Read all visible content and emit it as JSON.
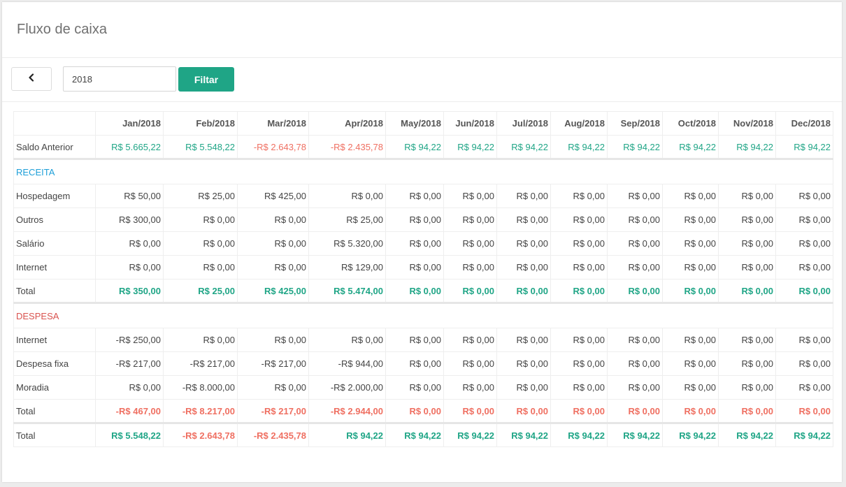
{
  "page_title": "Fluxo de caixa",
  "toolbar": {
    "back_icon": "chevron-left-icon",
    "year_value": "2018",
    "filter_label": "Filtar"
  },
  "colors": {
    "positive": "#1fa586",
    "negative": "#ef6f61",
    "receita": "#1e9fd8",
    "despesa": "#d9534f",
    "button": "#1fa586"
  },
  "table": {
    "months": [
      "Jan/2018",
      "Feb/2018",
      "Mar/2018",
      "Apr/2018",
      "May/2018",
      "Jun/2018",
      "Jul/2018",
      "Aug/2018",
      "Sep/2018",
      "Oct/2018",
      "Nov/2018",
      "Dec/2018"
    ],
    "saldo_anterior": {
      "label": "Saldo Anterior",
      "values": [
        "R$ 5.665,22",
        "R$ 5.548,22",
        "-R$ 2.643,78",
        "-R$ 2.435,78",
        "R$ 94,22",
        "R$ 94,22",
        "R$ 94,22",
        "R$ 94,22",
        "R$ 94,22",
        "R$ 94,22",
        "R$ 94,22",
        "R$ 94,22"
      ]
    },
    "receita": {
      "title": "RECEITA",
      "rows": [
        {
          "label": "Hospedagem",
          "values": [
            "R$ 50,00",
            "R$ 25,00",
            "R$ 425,00",
            "R$ 0,00",
            "R$ 0,00",
            "R$ 0,00",
            "R$ 0,00",
            "R$ 0,00",
            "R$ 0,00",
            "R$ 0,00",
            "R$ 0,00",
            "R$ 0,00"
          ]
        },
        {
          "label": "Outros",
          "values": [
            "R$ 300,00",
            "R$ 0,00",
            "R$ 0,00",
            "R$ 25,00",
            "R$ 0,00",
            "R$ 0,00",
            "R$ 0,00",
            "R$ 0,00",
            "R$ 0,00",
            "R$ 0,00",
            "R$ 0,00",
            "R$ 0,00"
          ]
        },
        {
          "label": "Salário",
          "values": [
            "R$ 0,00",
            "R$ 0,00",
            "R$ 0,00",
            "R$ 5.320,00",
            "R$ 0,00",
            "R$ 0,00",
            "R$ 0,00",
            "R$ 0,00",
            "R$ 0,00",
            "R$ 0,00",
            "R$ 0,00",
            "R$ 0,00"
          ]
        },
        {
          "label": "Internet",
          "values": [
            "R$ 0,00",
            "R$ 0,00",
            "R$ 0,00",
            "R$ 129,00",
            "R$ 0,00",
            "R$ 0,00",
            "R$ 0,00",
            "R$ 0,00",
            "R$ 0,00",
            "R$ 0,00",
            "R$ 0,00",
            "R$ 0,00"
          ]
        }
      ],
      "total": {
        "label": "Total",
        "values": [
          "R$ 350,00",
          "R$ 25,00",
          "R$ 425,00",
          "R$ 5.474,00",
          "R$ 0,00",
          "R$ 0,00",
          "R$ 0,00",
          "R$ 0,00",
          "R$ 0,00",
          "R$ 0,00",
          "R$ 0,00",
          "R$ 0,00"
        ]
      }
    },
    "despesa": {
      "title": "DESPESA",
      "rows": [
        {
          "label": "Internet",
          "values": [
            "-R$ 250,00",
            "R$ 0,00",
            "R$ 0,00",
            "R$ 0,00",
            "R$ 0,00",
            "R$ 0,00",
            "R$ 0,00",
            "R$ 0,00",
            "R$ 0,00",
            "R$ 0,00",
            "R$ 0,00",
            "R$ 0,00"
          ]
        },
        {
          "label": "Despesa fixa",
          "values": [
            "-R$ 217,00",
            "-R$ 217,00",
            "-R$ 217,00",
            "-R$ 944,00",
            "R$ 0,00",
            "R$ 0,00",
            "R$ 0,00",
            "R$ 0,00",
            "R$ 0,00",
            "R$ 0,00",
            "R$ 0,00",
            "R$ 0,00"
          ]
        },
        {
          "label": "Moradia",
          "values": [
            "R$ 0,00",
            "-R$ 8.000,00",
            "R$ 0,00",
            "-R$ 2.000,00",
            "R$ 0,00",
            "R$ 0,00",
            "R$ 0,00",
            "R$ 0,00",
            "R$ 0,00",
            "R$ 0,00",
            "R$ 0,00",
            "R$ 0,00"
          ]
        }
      ],
      "total": {
        "label": "Total",
        "values": [
          "-R$ 467,00",
          "-R$ 8.217,00",
          "-R$ 217,00",
          "-R$ 2.944,00",
          "R$ 0,00",
          "R$ 0,00",
          "R$ 0,00",
          "R$ 0,00",
          "R$ 0,00",
          "R$ 0,00",
          "R$ 0,00",
          "R$ 0,00"
        ]
      }
    },
    "grand_total": {
      "label": "Total",
      "values": [
        "R$ 5.548,22",
        "-R$ 2.643,78",
        "-R$ 2.435,78",
        "R$ 94,22",
        "R$ 94,22",
        "R$ 94,22",
        "R$ 94,22",
        "R$ 94,22",
        "R$ 94,22",
        "R$ 94,22",
        "R$ 94,22",
        "R$ 94,22"
      ]
    }
  }
}
